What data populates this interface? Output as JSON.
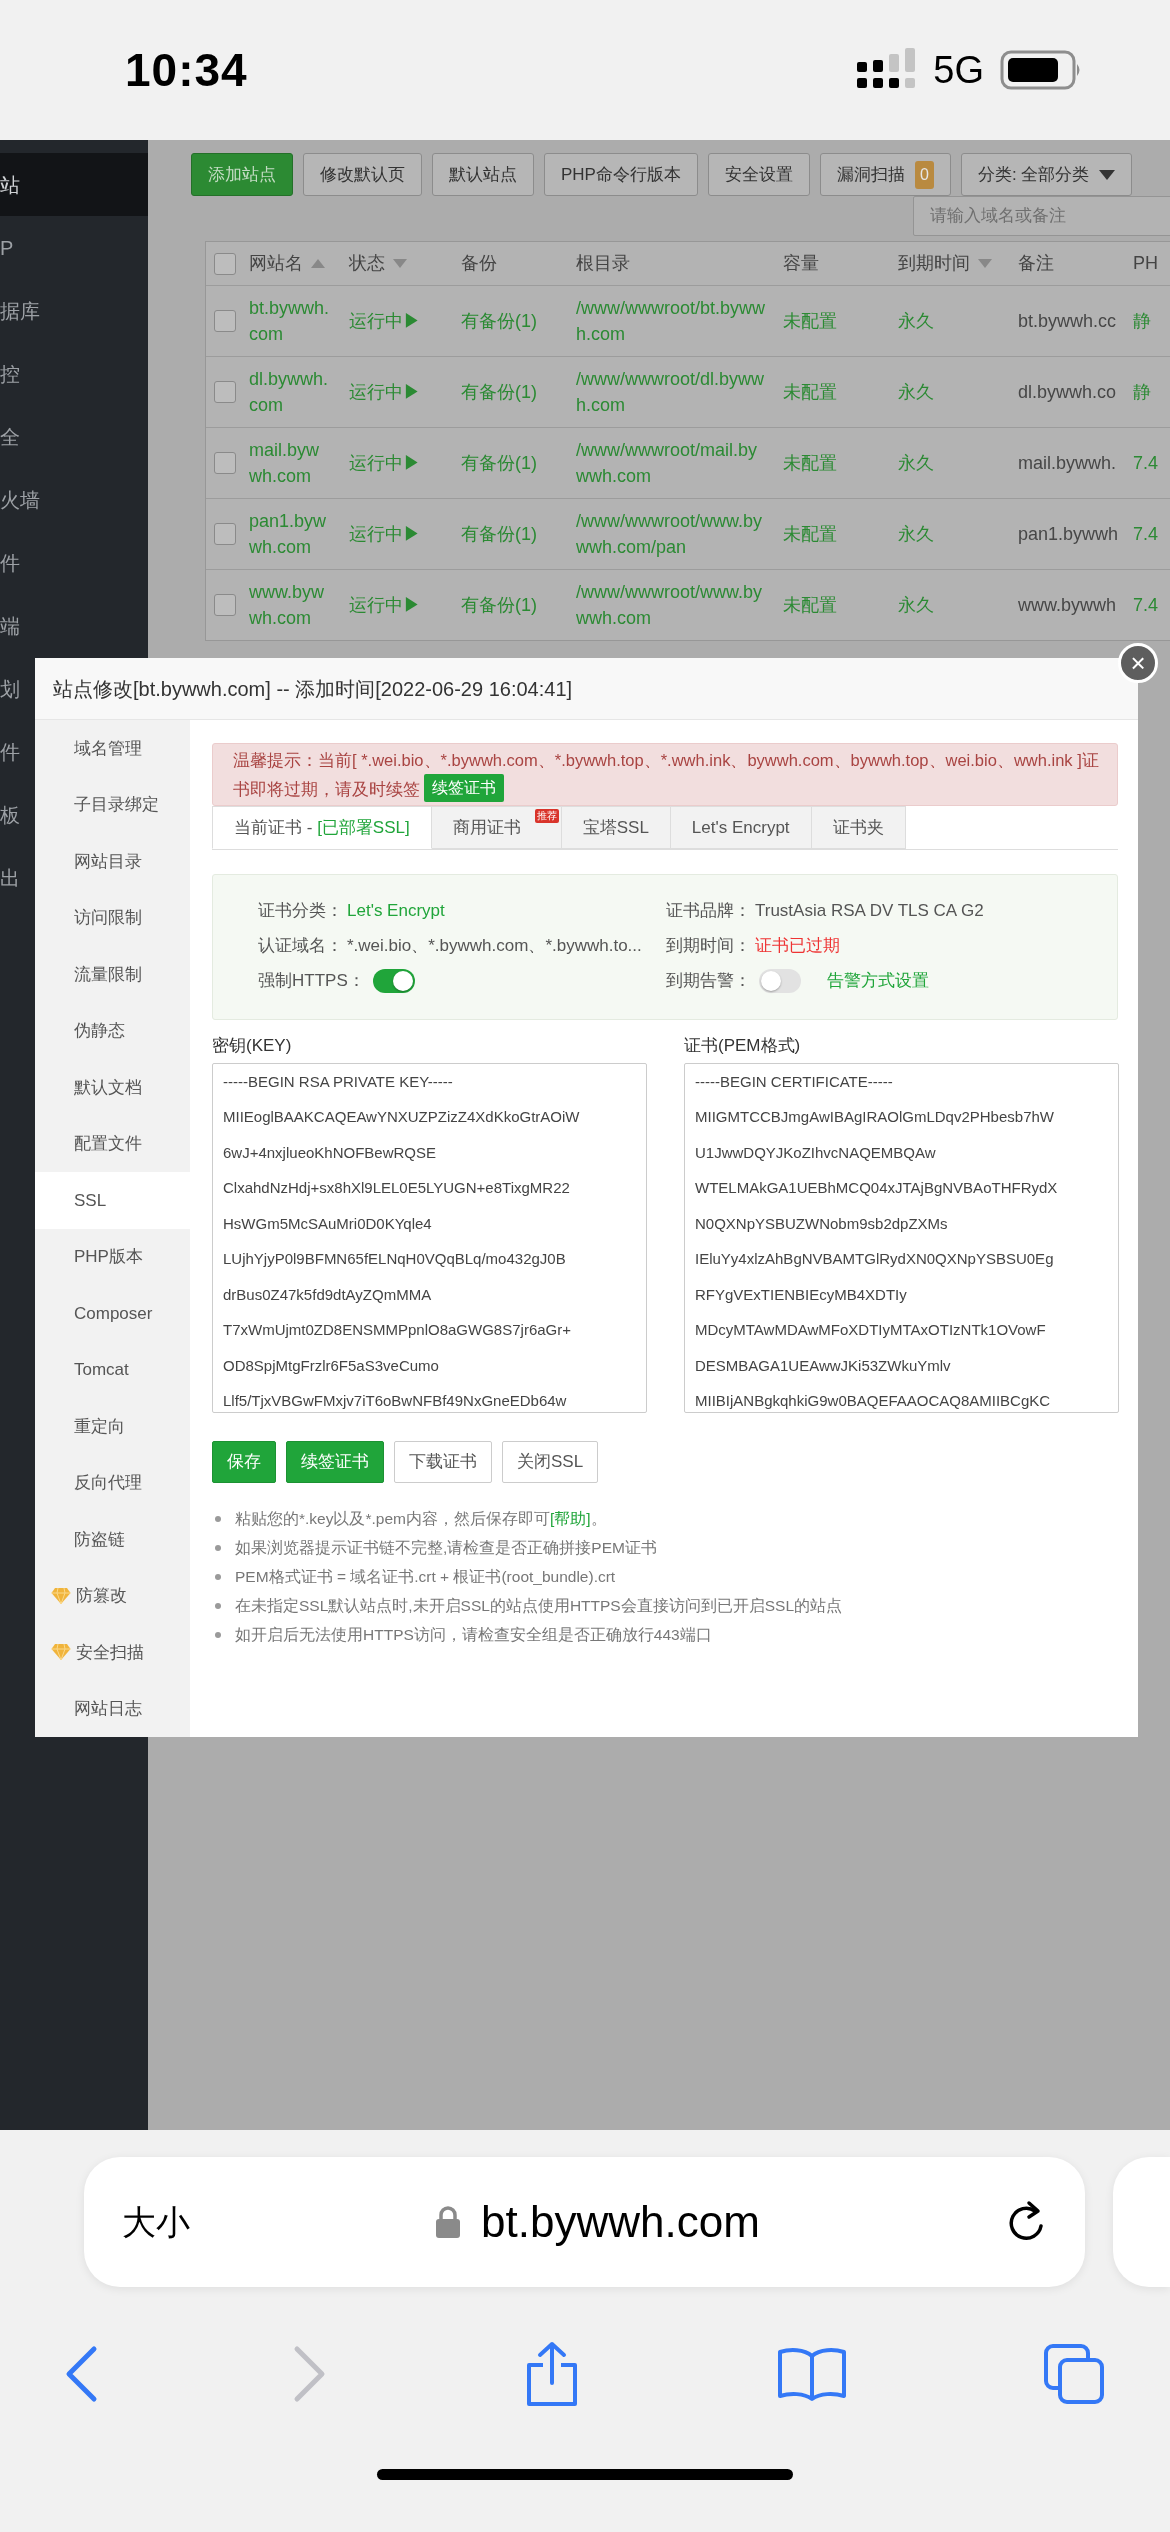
{
  "status_bar": {
    "time": "10:34",
    "network": "5G"
  },
  "sidebar": {
    "items": [
      {
        "label": "站",
        "selected": true
      },
      {
        "label": "P",
        "selected": false
      },
      {
        "label": "据库",
        "selected": false
      },
      {
        "label": "控",
        "selected": false
      },
      {
        "label": "全",
        "selected": false
      },
      {
        "label": "火墙",
        "selected": false
      },
      {
        "label": "件",
        "selected": false
      },
      {
        "label": "端",
        "selected": false
      },
      {
        "label": "划",
        "selected": false
      },
      {
        "label": "件",
        "selected": false
      },
      {
        "label": "板",
        "selected": false
      },
      {
        "label": "出",
        "selected": false
      }
    ]
  },
  "toolbar": {
    "buttons": [
      {
        "label": "添加站点",
        "kind": "primary"
      },
      {
        "label": "修改默认页",
        "kind": "default"
      },
      {
        "label": "默认站点",
        "kind": "default"
      },
      {
        "label": "PHP命令行版本",
        "kind": "default"
      },
      {
        "label": "安全设置",
        "kind": "default"
      },
      {
        "label": "漏洞扫描",
        "kind": "default",
        "badge": "0"
      }
    ],
    "category": {
      "label": "分类: 全部分类"
    },
    "search": {
      "placeholder": "请输入域名或备注"
    }
  },
  "table": {
    "columns": [
      {
        "label": "网站名",
        "kind": "ascending"
      },
      {
        "label": "状态",
        "kind": "descending"
      },
      {
        "label": "备份",
        "kind": "plain"
      },
      {
        "label": "根目录",
        "kind": "plain"
      },
      {
        "label": "容量",
        "kind": "plain"
      },
      {
        "label": "到期时间",
        "kind": "descending"
      },
      {
        "label": "备注",
        "kind": "plain"
      },
      {
        "label": "PH",
        "kind": "plain"
      }
    ],
    "header_checked": false,
    "rows": [
      {
        "checked": false,
        "cells": [
          "bt.bywwh.com",
          "运行中▶",
          "有备份(1)",
          "/www/wwwroot/bt.bywwh.com",
          "未配置",
          "永久",
          "bt.bywwh.cc",
          "静"
        ]
      },
      {
        "checked": false,
        "cells": [
          "dl.bywwh.com",
          "运行中▶",
          "有备份(1)",
          "/www/wwwroot/dl.bywwh.com",
          "未配置",
          "永久",
          "dl.bywwh.co",
          "静"
        ]
      },
      {
        "checked": false,
        "cells": [
          "mail.bywwh.com",
          "运行中▶",
          "有备份(1)",
          "/www/wwwroot/mail.bywwh.com",
          "未配置",
          "永久",
          "mail.bywwh.",
          "7.4"
        ]
      },
      {
        "checked": false,
        "cells": [
          "pan1.bywwh.com",
          "运行中▶",
          "有备份(1)",
          "/www/wwwroot/www.bywwh.com/pan",
          "未配置",
          "永久",
          "pan1.bywwh",
          "7.4"
        ]
      },
      {
        "checked": false,
        "cells": [
          "www.bywwh.com",
          "运行中▶",
          "有备份(1)",
          "/www/wwwroot/www.bywwh.com",
          "未配置",
          "永久",
          "www.bywwh",
          "7.4"
        ]
      }
    ]
  },
  "dialog": {
    "title": "站点修改[bt.bywwh.com] -- 添加时间[2022-06-29 16:04:41]",
    "close": "×",
    "menu": [
      {
        "label": "域名管理",
        "selected": false
      },
      {
        "label": "子目录绑定",
        "selected": false
      },
      {
        "label": "网站目录",
        "selected": false
      },
      {
        "label": "访问限制",
        "selected": false
      },
      {
        "label": "流量限制",
        "selected": false
      },
      {
        "label": "伪静态",
        "selected": false
      },
      {
        "label": "默认文档",
        "selected": false
      },
      {
        "label": "配置文件",
        "selected": false
      },
      {
        "label": "SSL",
        "selected": true
      },
      {
        "label": "PHP版本",
        "selected": false
      },
      {
        "label": "Composer",
        "selected": false
      },
      {
        "label": "Tomcat",
        "selected": false
      },
      {
        "label": "重定向",
        "selected": false
      },
      {
        "label": "反向代理",
        "selected": false
      },
      {
        "label": "防盗链",
        "selected": false
      },
      {
        "label": "防篡改",
        "selected": false,
        "kind": "premium"
      },
      {
        "label": "安全扫描",
        "selected": false,
        "kind": "premium"
      },
      {
        "label": "网站日志",
        "selected": false
      }
    ],
    "warning": {
      "text": "温馨提示：当前[ *.wei.bio、*.bywwh.com、*.bywwh.top、*.wwh.ink、bywwh.com、bywwh.top、wei.bio、wwh.ink ]证书即将过期，请及时续签",
      "action": "续签证书"
    },
    "tabs": [
      {
        "label": "当前证书 -",
        "status": "[已部署SSL]",
        "selected": true
      },
      {
        "label": "商用证书",
        "ribbon": "推荐",
        "selected": false
      },
      {
        "label": "宝塔SSL",
        "selected": false
      },
      {
        "label": "Let's Encrypt",
        "selected": false
      },
      {
        "label": "证书夹",
        "selected": false
      }
    ],
    "info": [
      {
        "kind": "success",
        "label": "证书分类：",
        "value": "Let's Encrypt"
      },
      {
        "kind": "plain",
        "label": "证书品牌：",
        "value": "TrustAsia RSA DV TLS CA G2"
      },
      {
        "kind": "plain",
        "label": "认证域名：",
        "value": "*.wei.bio、*.bywwh.com、*.bywwh.to..."
      },
      {
        "kind": "danger",
        "label": "到期时间：",
        "value": "证书已过期"
      },
      {
        "kind": "switch",
        "label": "强制HTTPS：",
        "on": true
      },
      {
        "kind": "switch",
        "label": "到期告警：",
        "on": false,
        "link": "告警方式设置"
      }
    ],
    "key": {
      "label": "密钥(KEY)",
      "lines": [
        "-----BEGIN RSA PRIVATE KEY-----",
        "MIIEoglBAAKCAQEAwYNXUZPZizZ4XdKkoGtrAOiW",
        "6wJ+4nxjlueoKhNOFBewRQSE",
        "ClxahdNzHdj+sx8hXl9LEL0E5LYUGN+e8TixgMR22",
        "HsWGm5McSAuMri0D0KYqle4",
        "LUjhYjyP0l9BFMN65fELNqH0VQqBLq/mo432gJ0B",
        "drBus0Z47k5fd9dtAyZQmMMA",
        "T7xWmUjmt0ZD8ENSMMPpnlO8aGWG8S7jr6aGr+",
        "OD8SpjMtgFrzlr6F5aS3veCumo",
        "Llf5/TjxVBGwFMxjv7iT6oBwNFBf49NxGneEDb64w"
      ]
    },
    "cert": {
      "label": "证书(PEM格式)",
      "lines": [
        "-----BEGIN CERTIFICATE-----",
        "MIIGMTCCBJmgAwIBAgIRAOlGmLDqv2PHbesb7hW",
        "U1JwwDQYJKoZIhvcNAQEMBQAw",
        "WTELMAkGA1UEBhMCQ04xJTAjBgNVBAoTHFRydX",
        "N0QXNpYSBUZWNobm9sb2dpZXMs",
        "IEluYy4xlzAhBgNVBAMTGlRydXN0QXNpYSBSU0Eg",
        "RFYgVExTIENBIEcyMB4XDTIy",
        "MDcyMTAwMDAwMFoXDTIyMTAxOTIzNTk1OVowF",
        "DESMBAGA1UEAwwJKi53ZWkuYmlv",
        "MIIBIjANBgkqhkiG9w0BAQEFAAOCAQ8AMIIBCgKC"
      ]
    },
    "buttons": [
      {
        "label": "保存",
        "kind": "primary"
      },
      {
        "label": "续签证书",
        "kind": "primary"
      },
      {
        "label": "下载证书",
        "kind": "default"
      },
      {
        "label": "关闭SSL",
        "kind": "default"
      }
    ],
    "notes": [
      {
        "text": "粘贴您的*.key以及*.pem内容，然后保存即可",
        "link": "[帮助]",
        "suffix": "。"
      },
      {
        "text": "如果浏览器提示证书链不完整,请检查是否正确拼接PEM证书"
      },
      {
        "text": "PEM格式证书 = 域名证书.crt + 根证书(root_bundle).crt"
      },
      {
        "text": "在未指定SSL默认站点时,未开启SSL的站点使用HTTPS会直接访问到已开启SSL的站点"
      },
      {
        "text": "如开启后无法使用HTTPS访问，请检查安全组是否正确放行443端口"
      }
    ]
  },
  "browser": {
    "text_size": "大小",
    "url": "bt.bywwh.com"
  }
}
